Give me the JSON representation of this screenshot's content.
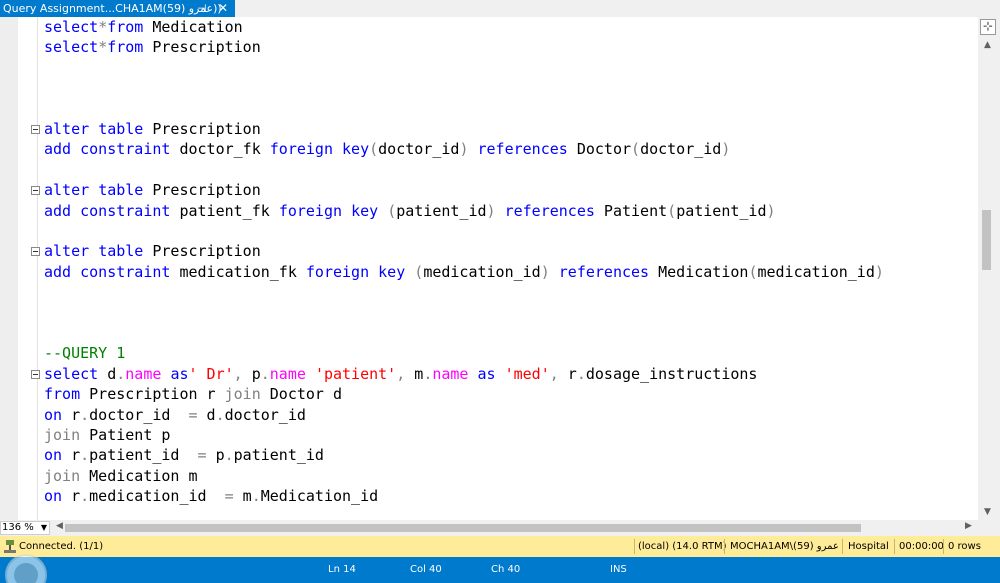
{
  "tab": {
    "title": "Query Assignment...CHA1AM(59) عمرو))",
    "pin_icon": "pin-icon",
    "close_label": "✕"
  },
  "code_lines": [
    [
      [
        "kw",
        "select"
      ],
      [
        "gray",
        "*"
      ],
      [
        "kw",
        "from"
      ],
      [
        "p",
        " Medication"
      ]
    ],
    [
      [
        "kw",
        "select"
      ],
      [
        "gray",
        "*"
      ],
      [
        "kw",
        "from"
      ],
      [
        "p",
        " Prescription"
      ]
    ],
    [],
    [],
    [],
    [
      [
        "kw",
        "alter"
      ],
      [
        "p",
        " "
      ],
      [
        "kw",
        "table"
      ],
      [
        "p",
        " Prescription"
      ]
    ],
    [
      [
        "kw",
        "add"
      ],
      [
        "p",
        " "
      ],
      [
        "kw",
        "constraint"
      ],
      [
        "p",
        " doctor_fk "
      ],
      [
        "kw",
        "foreign"
      ],
      [
        "p",
        " "
      ],
      [
        "kw",
        "key"
      ],
      [
        "gray",
        "("
      ],
      [
        "p",
        "doctor_id"
      ],
      [
        "gray",
        ")"
      ],
      [
        "p",
        " "
      ],
      [
        "kw",
        "references"
      ],
      [
        "p",
        " Doctor"
      ],
      [
        "gray",
        "("
      ],
      [
        "p",
        "doctor_id"
      ],
      [
        "gray",
        ")"
      ]
    ],
    [],
    [
      [
        "kw",
        "alter"
      ],
      [
        "p",
        " "
      ],
      [
        "kw",
        "table"
      ],
      [
        "p",
        " Prescription"
      ]
    ],
    [
      [
        "kw",
        "add"
      ],
      [
        "p",
        " "
      ],
      [
        "kw",
        "constraint"
      ],
      [
        "p",
        " patient_fk "
      ],
      [
        "kw",
        "foreign"
      ],
      [
        "p",
        " "
      ],
      [
        "kw",
        "key"
      ],
      [
        "p",
        " "
      ],
      [
        "gray",
        "("
      ],
      [
        "p",
        "patient_id"
      ],
      [
        "gray",
        ")"
      ],
      [
        "p",
        " "
      ],
      [
        "kw",
        "references"
      ],
      [
        "p",
        " Patient"
      ],
      [
        "gray",
        "("
      ],
      [
        "p",
        "patient_id"
      ],
      [
        "gray",
        ")"
      ]
    ],
    [],
    [
      [
        "kw",
        "alter"
      ],
      [
        "p",
        " "
      ],
      [
        "kw",
        "table"
      ],
      [
        "p",
        " Prescription"
      ]
    ],
    [
      [
        "kw",
        "add"
      ],
      [
        "p",
        " "
      ],
      [
        "kw",
        "constraint"
      ],
      [
        "p",
        " medication_fk "
      ],
      [
        "kw",
        "foreign"
      ],
      [
        "p",
        " "
      ],
      [
        "kw",
        "key"
      ],
      [
        "p",
        " "
      ],
      [
        "gray",
        "("
      ],
      [
        "p",
        "medication_id"
      ],
      [
        "gray",
        ")"
      ],
      [
        "p",
        " "
      ],
      [
        "kw",
        "references"
      ],
      [
        "p",
        " Medication"
      ],
      [
        "gray",
        "("
      ],
      [
        "p",
        "medication_id"
      ],
      [
        "gray",
        ")"
      ]
    ],
    [],
    [],
    [],
    [
      [
        "cmt",
        "--QUERY 1"
      ]
    ],
    [
      [
        "kw",
        "select"
      ],
      [
        "p",
        " d"
      ],
      [
        "gray",
        "."
      ],
      [
        "fn",
        "name"
      ],
      [
        "p",
        " "
      ],
      [
        "kw",
        "as"
      ],
      [
        "str",
        "' Dr'"
      ],
      [
        "gray",
        ","
      ],
      [
        "p",
        " p"
      ],
      [
        "gray",
        "."
      ],
      [
        "fn",
        "name"
      ],
      [
        "p",
        " "
      ],
      [
        "str",
        "'patient'"
      ],
      [
        "gray",
        ","
      ],
      [
        "p",
        " m"
      ],
      [
        "gray",
        "."
      ],
      [
        "fn",
        "name"
      ],
      [
        "p",
        " "
      ],
      [
        "kw",
        "as"
      ],
      [
        "p",
        " "
      ],
      [
        "str",
        "'med'"
      ],
      [
        "gray",
        ","
      ],
      [
        "p",
        " r"
      ],
      [
        "gray",
        "."
      ],
      [
        "p",
        "dosage_instructions"
      ]
    ],
    [
      [
        "kw",
        "from"
      ],
      [
        "p",
        " Prescription r "
      ],
      [
        "gray",
        "join"
      ],
      [
        "p",
        " Doctor d"
      ]
    ],
    [
      [
        "kw",
        "on"
      ],
      [
        "p",
        " r"
      ],
      [
        "gray",
        "."
      ],
      [
        "p",
        "doctor_id  "
      ],
      [
        "gray",
        "="
      ],
      [
        "p",
        " d"
      ],
      [
        "gray",
        "."
      ],
      [
        "p",
        "doctor_id"
      ]
    ],
    [
      [
        "gray",
        "join"
      ],
      [
        "p",
        " Patient p"
      ]
    ],
    [
      [
        "kw",
        "on"
      ],
      [
        "p",
        " r"
      ],
      [
        "gray",
        "."
      ],
      [
        "p",
        "patient_id  "
      ],
      [
        "gray",
        "="
      ],
      [
        "p",
        " p"
      ],
      [
        "gray",
        "."
      ],
      [
        "p",
        "patient_id"
      ]
    ],
    [
      [
        "gray",
        "join"
      ],
      [
        "p",
        " Medication m"
      ]
    ],
    [
      [
        "kw",
        "on"
      ],
      [
        "p",
        " r"
      ],
      [
        "gray",
        "."
      ],
      [
        "p",
        "medication_id  "
      ],
      [
        "gray",
        "="
      ],
      [
        "p",
        " m"
      ],
      [
        "gray",
        "."
      ],
      [
        "p",
        "Medication_id"
      ]
    ]
  ],
  "fold_lines": [
    5,
    8,
    11,
    17
  ],
  "editor": {
    "split_icon": "⊹"
  },
  "zoom": {
    "value": "136 %"
  },
  "status": {
    "connection": "Connected. (1/1)",
    "server": "(local) (14.0 RTM)",
    "user": "MOCHA1AM\\عمرو (59)",
    "database": "Hospital",
    "elapsed": "00:00:00",
    "rows": "0 rows"
  },
  "bottom": {
    "ln": "Ln 14",
    "col": "Col 40",
    "ch": "Ch 40",
    "mode": "INS"
  },
  "colors": {
    "accent": "#007acc",
    "status_bg": "#ffec98",
    "keyword": "#0000ff",
    "string": "#ff0000",
    "function": "#ff00ff",
    "comment": "#008000"
  }
}
